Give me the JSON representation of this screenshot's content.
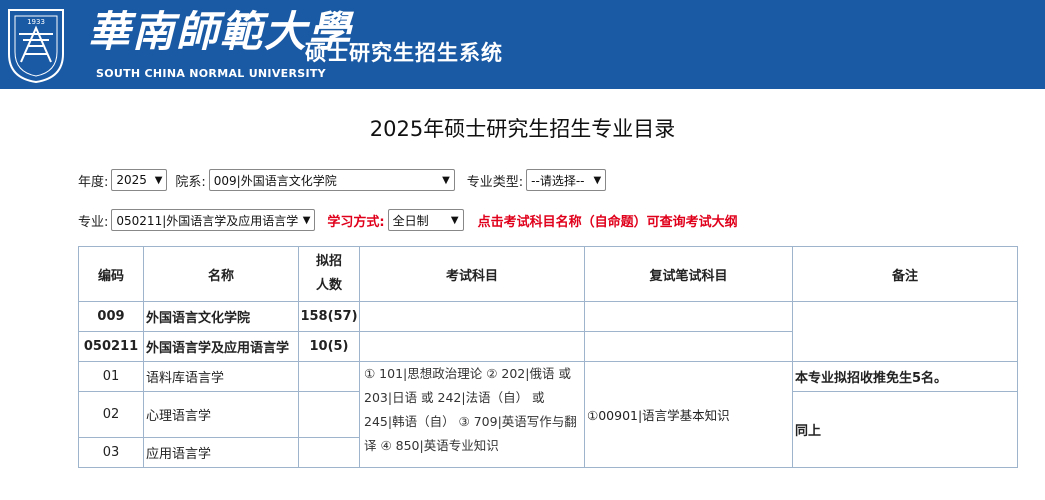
{
  "header": {
    "badge_year": "1933",
    "cn_logo": "華南師範大學",
    "system_title": "硕士研究生招生系统",
    "en_name": "SOUTH CHINA NORMAL UNIVERSITY",
    "badge_ring_text": "SOUTH CHINA NORMAL UNIVERSITY",
    "colors": {
      "banner": "#1a5aa5",
      "accent_red": "#e0001b"
    }
  },
  "page_title": "2025年硕士研究生招生专业目录",
  "filters": {
    "year_label": "年度:",
    "year_value": "2025",
    "dept_label": "院系:",
    "dept_value": "009|外国语言文化学院",
    "type_label": "专业类型:",
    "type_value": "--请选择--",
    "major_label": "专业:",
    "major_value": "050211|外国语言学及应用语言学",
    "mode_label": "学习方式:",
    "mode_value": "全日制",
    "hint": "点击考试科目名称（自命题）可查询考试大纲"
  },
  "table": {
    "headers": {
      "code": "编码",
      "name": "名称",
      "quota_line1": "拟招",
      "quota_line2": "人数",
      "exam": "考试科目",
      "retest": "复试笔试科目",
      "notes": "备注"
    },
    "dept_row": {
      "code": "009",
      "name": "外国语言文化学院",
      "quota": "158(57)"
    },
    "major_row": {
      "code": "050211",
      "name": "外国语言学及应用语言学",
      "quota": "10(5)"
    },
    "directions": [
      {
        "code": "01",
        "name": "语料库语言学"
      },
      {
        "code": "02",
        "name": "心理语言学"
      },
      {
        "code": "03",
        "name": "应用语言学"
      }
    ],
    "exam_lines": [
      "① 101|思想政治理论  ② 202|俄语 或",
      "203|日语 或  242|法语（自） 或",
      "245|韩语（自） ③ 709|英语写作与翻",
      "译 ④ 850|英语专业知识"
    ],
    "retest": "①00901|语言学基本知识",
    "note1": "本专业拟招收推免生5名。",
    "note2": "同上"
  }
}
